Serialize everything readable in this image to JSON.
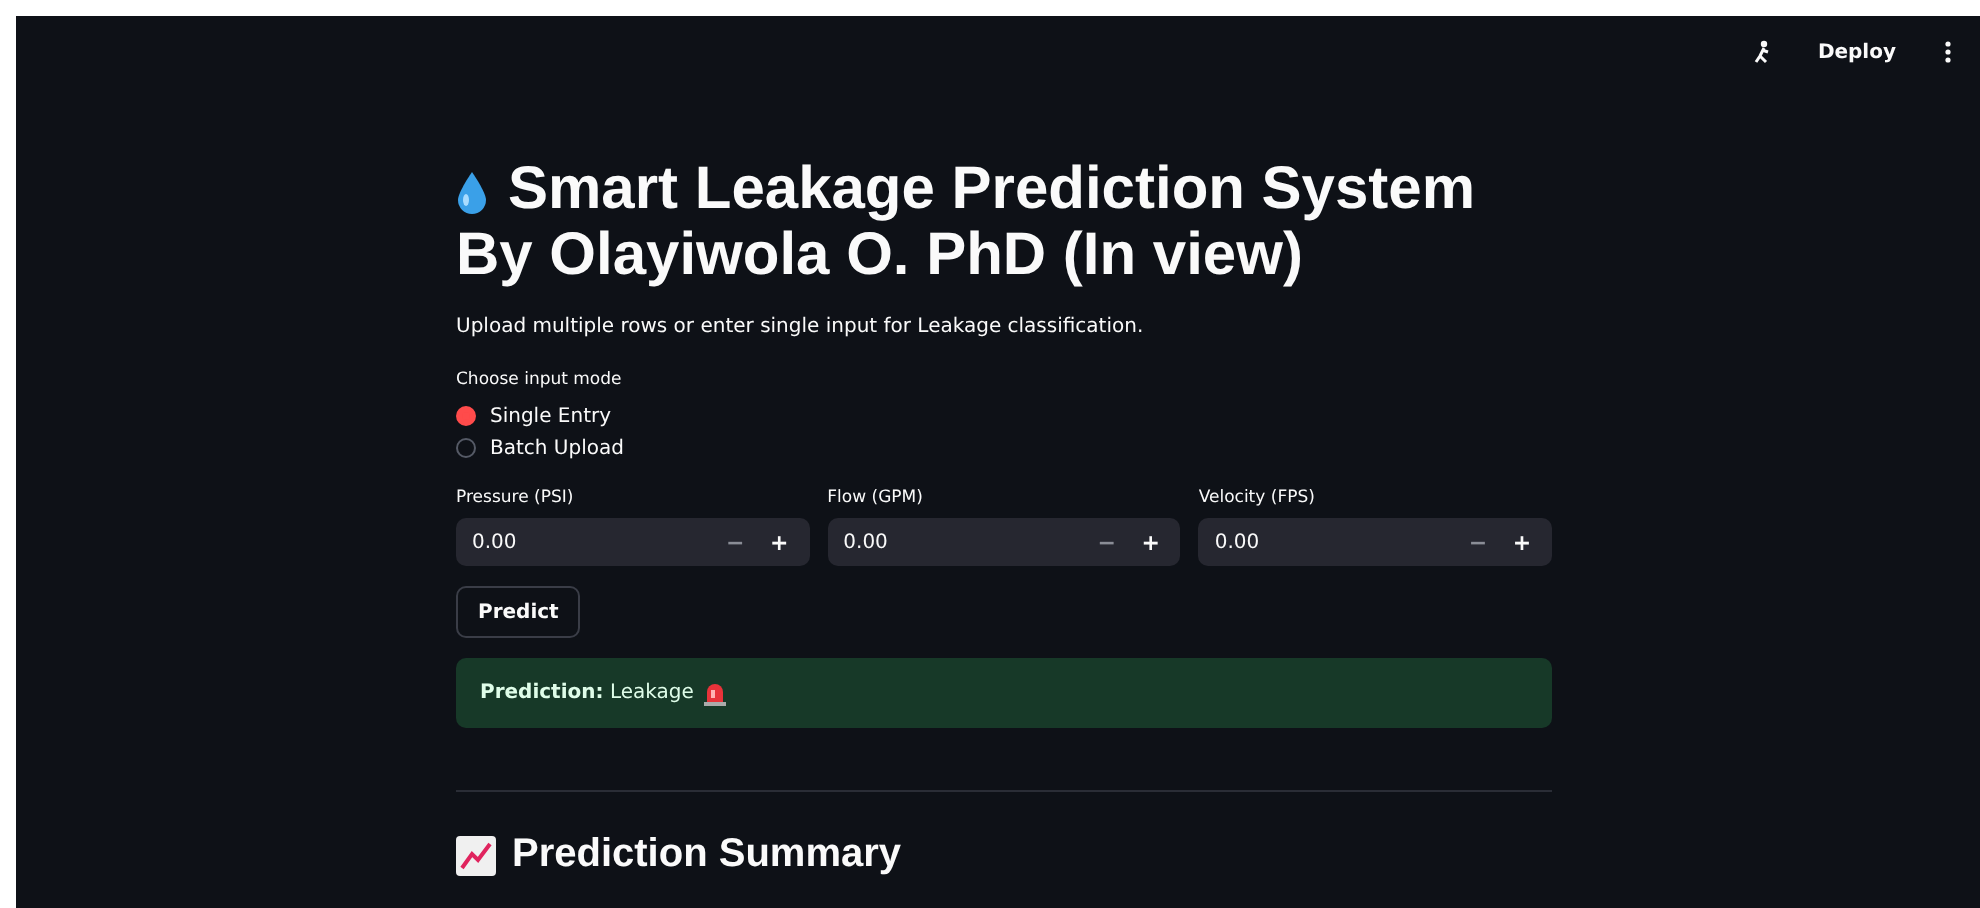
{
  "toolbar": {
    "deploy": "Deploy"
  },
  "title": "Smart Leakage Prediction System By Olayiwola O. PhD (In view)",
  "subtitle": "Upload multiple rows or enter single input for Leakage classification.",
  "input_mode": {
    "label": "Choose input mode",
    "options": [
      {
        "label": "Single Entry",
        "selected": true
      },
      {
        "label": "Batch Upload",
        "selected": false
      }
    ]
  },
  "inputs": [
    {
      "label": "Pressure (PSI)",
      "value": "0.00",
      "minus": "−",
      "plus": "+"
    },
    {
      "label": "Flow (GPM)",
      "value": "0.00",
      "minus": "−",
      "plus": "+"
    },
    {
      "label": "Velocity (FPS)",
      "value": "0.00",
      "minus": "−",
      "plus": "+"
    }
  ],
  "button": "Predict",
  "alert": {
    "text": "**Prediction:** Leakage"
  },
  "summary_heading": "Prediction Summary"
}
